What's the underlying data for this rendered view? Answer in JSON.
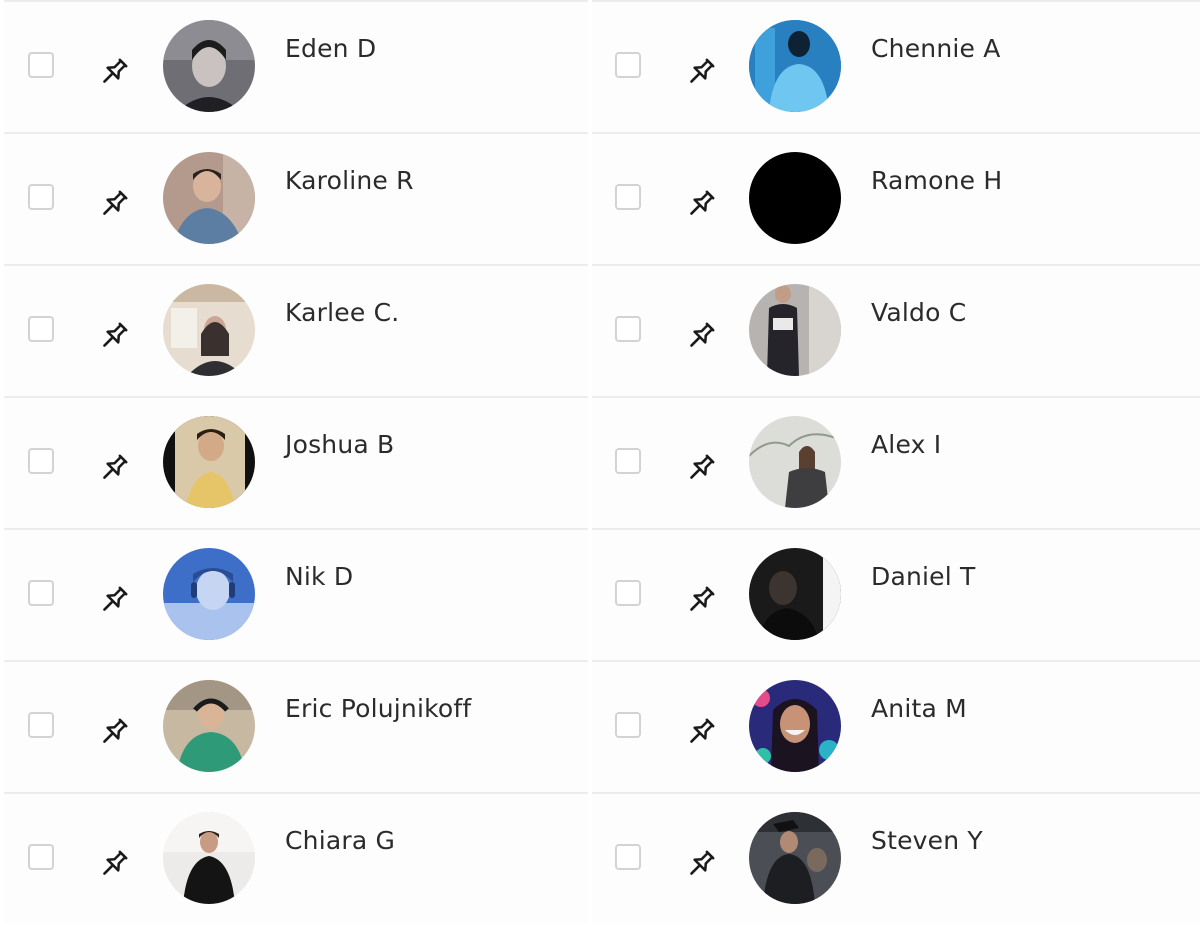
{
  "participants": {
    "left": [
      {
        "name": "Eden D"
      },
      {
        "name": "Karoline R"
      },
      {
        "name": "Karlee C."
      },
      {
        "name": "Joshua B"
      },
      {
        "name": "Nik D"
      },
      {
        "name": "Eric Polujnikoff"
      },
      {
        "name": "Chiara G"
      }
    ],
    "right": [
      {
        "name": "Chennie A"
      },
      {
        "name": "Ramone H"
      },
      {
        "name": "Valdo C"
      },
      {
        "name": "Alex I"
      },
      {
        "name": "Daniel T"
      },
      {
        "name": "Anita M"
      },
      {
        "name": "Steven Y"
      }
    ]
  },
  "icons": {
    "checkbox": "checkbox-unchecked",
    "pin": "pushpin-outline-icon"
  },
  "colors": {
    "divider": "#ececec",
    "checkbox_border": "#d3d3d3",
    "text": "#2b2b2b"
  }
}
